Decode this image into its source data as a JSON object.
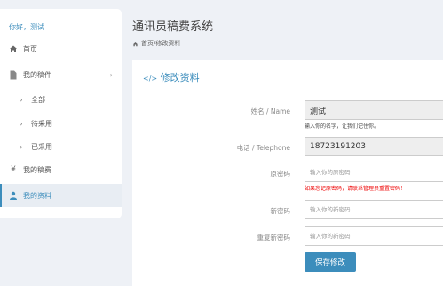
{
  "sidebar": {
    "greeting": "你好，测试",
    "items": [
      {
        "label": "首页",
        "icon": "home-icon"
      },
      {
        "label": "我的稿件",
        "icon": "file-icon"
      },
      {
        "label": "全部",
        "icon": "chevron-right-icon"
      },
      {
        "label": "待采用",
        "icon": "chevron-right-icon"
      },
      {
        "label": "已采用",
        "icon": "chevron-right-icon"
      },
      {
        "label": "我的稿费",
        "icon": "yen-icon"
      },
      {
        "label": "我的资料",
        "icon": "user-icon"
      }
    ]
  },
  "header": {
    "title": "通讯员稿费系统",
    "breadcrumb": "首页/修改资料"
  },
  "panel": {
    "title": "修改资料",
    "title_icon": "code-icon"
  },
  "form": {
    "name_label": "姓名 / Name",
    "name_value": "测试",
    "name_help": "输入你的名字，让我们记住你。",
    "phone_label": "电话 / Telephone",
    "phone_value": "18723191203",
    "old_password_label": "原密码",
    "old_password_placeholder": "输入你的原密码",
    "old_password_help": "如果忘记原密码，请联系管理员重置密码！",
    "new_password_label": "新密码",
    "new_password_placeholder": "输入你的新密码",
    "repeat_password_label": "重复新密码",
    "repeat_password_placeholder": "输入你的新密码",
    "save_label": "保存修改"
  },
  "colors": {
    "accent": "#3c8dbc",
    "warning": "#ee0000"
  }
}
